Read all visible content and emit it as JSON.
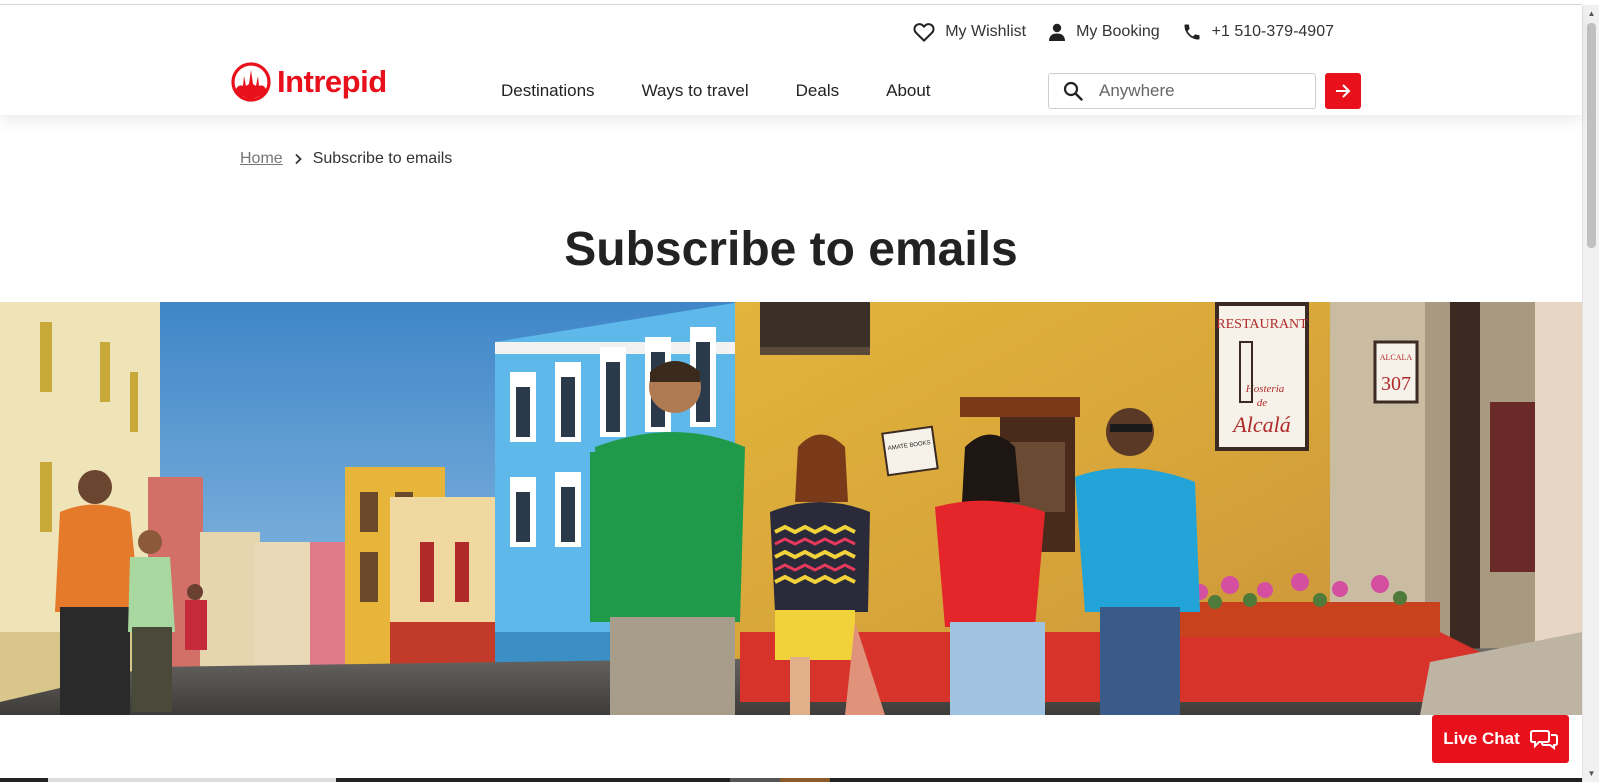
{
  "header": {
    "wishlist_label": "My Wishlist",
    "booking_label": "My Booking",
    "phone": "+1 510-379-4907",
    "logo_text": "Intrepid",
    "nav": [
      {
        "label": "Destinations"
      },
      {
        "label": "Ways to travel"
      },
      {
        "label": "Deals"
      },
      {
        "label": "About"
      }
    ],
    "search_placeholder": "Anywhere"
  },
  "breadcrumb": {
    "home": "Home",
    "current": "Subscribe to emails"
  },
  "page_title": "Subscribe to emails",
  "hero": {
    "signs": {
      "restaurant": "RESTAURANT",
      "hosteria": "Hosteria",
      "de": "de",
      "alcala": "Alcalá",
      "street": "ALCALA",
      "number": "307",
      "books": "AMATE BOOKS"
    }
  },
  "live_chat": {
    "label": "Live Chat"
  },
  "colors": {
    "brand": "#e8101a",
    "text": "#222222"
  },
  "icons": [
    "heart-icon",
    "user-icon",
    "phone-icon",
    "search-icon",
    "arrow-right-icon",
    "chevron-right-icon",
    "chat-bubbles-icon"
  ]
}
